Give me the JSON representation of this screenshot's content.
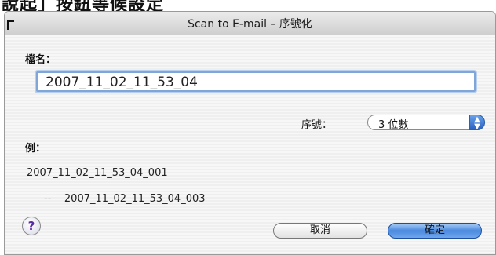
{
  "window": {
    "title": "Scan to E-mail – 序號化"
  },
  "form": {
    "filename_label": "檔名：",
    "filename_value": "2007_11_02_11_53_04",
    "serial_label": "序號：",
    "serial_selected": "3 位數"
  },
  "example": {
    "label": "例：",
    "line1": "2007_11_02_11_53_04_001",
    "line2": "--    2007_11_02_11_53_04_003"
  },
  "buttons": {
    "help": "?",
    "cancel": "取消",
    "ok": "確定"
  },
  "icons": {
    "help": "question-mark-icon",
    "select": "up-down-arrows-icon"
  }
}
